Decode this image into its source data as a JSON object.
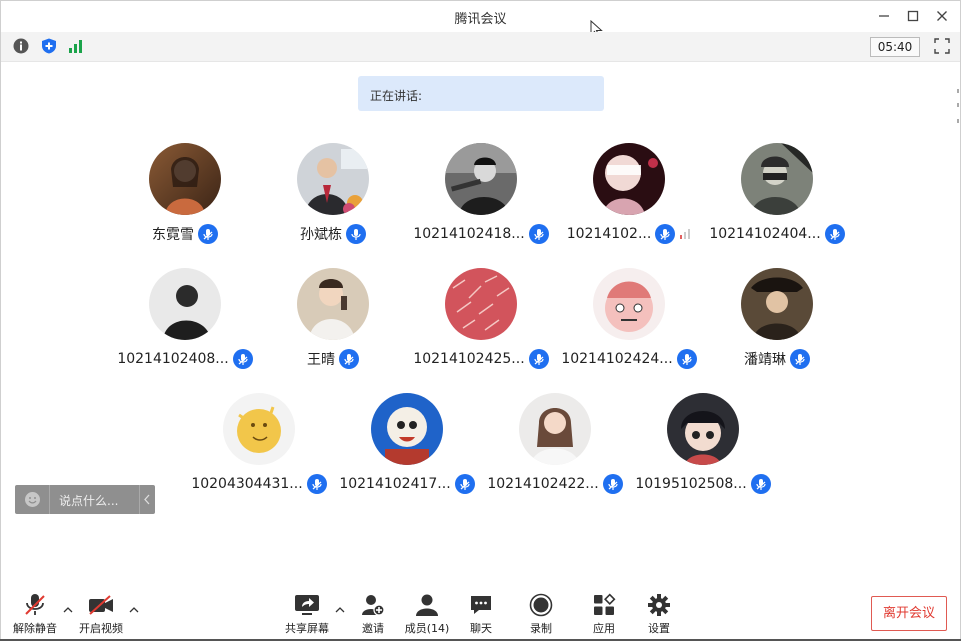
{
  "window": {
    "title": "腾讯会议"
  },
  "infobar": {
    "timer": "05:40"
  },
  "speaking": {
    "label": "正在讲话:"
  },
  "participants": [
    {
      "name": "东霓雪"
    },
    {
      "name": "孙斌栋"
    },
    {
      "name": "10214102418..."
    },
    {
      "name": "10214102..."
    },
    {
      "name": "10214102404..."
    },
    {
      "name": "10214102408..."
    },
    {
      "name": "王晴"
    },
    {
      "name": "10214102425..."
    },
    {
      "name": "10214102424..."
    },
    {
      "name": "潘靖琳"
    },
    {
      "name": "10204304431..."
    },
    {
      "name": "10214102417..."
    },
    {
      "name": "10214102422..."
    },
    {
      "name": "10195102508..."
    }
  ],
  "chat": {
    "placeholder": "说点什么..."
  },
  "toolbar": {
    "unmute": "解除静音",
    "start_video": "开启视频",
    "share_screen": "共享屏幕",
    "invite": "邀请",
    "members": "成员(14)",
    "chat": "聊天",
    "record": "录制",
    "apps": "应用",
    "settings": "设置",
    "leave": "离开会议"
  },
  "colors": {
    "accent": "#1f6ff0",
    "leave": "#e03a31",
    "speaking_bg": "#dce9fb"
  }
}
